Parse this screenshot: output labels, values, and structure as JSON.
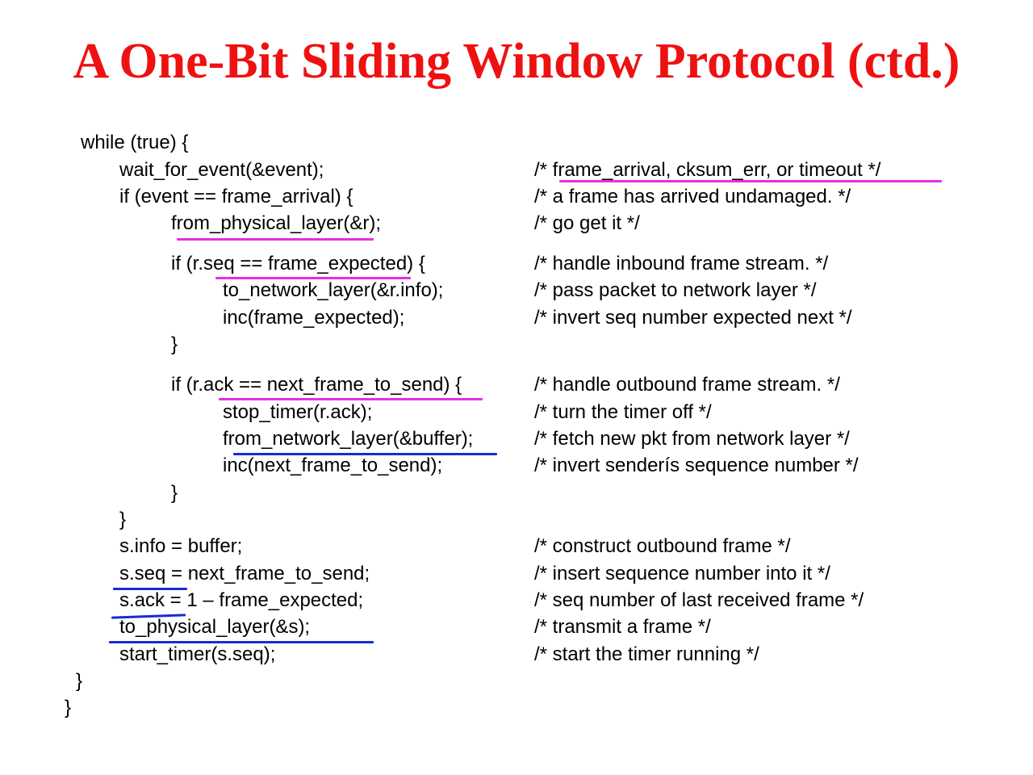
{
  "title": "A One-Bit Sliding Window Protocol (ctd.)",
  "colors": {
    "title": "#ee1111",
    "highlight_magenta": "#e62ee6",
    "highlight_blue": "#1a2ad6"
  },
  "code": [
    {
      "text": "while (true) {",
      "comment": ""
    },
    {
      "text": "wait_for_event(&event);",
      "comment": "/* frame_arrival, cksum_err, or timeout */"
    },
    {
      "text": "if (event == frame_arrival) {",
      "comment": "/* a frame has arrived undamaged. */"
    },
    {
      "text": "from_physical_layer(&r);",
      "comment": "/* go get it */"
    },
    {
      "text": "if (r.seq == frame_expected) {",
      "comment": "/* handle inbound frame stream. */"
    },
    {
      "text": "to_network_layer(&r.info);",
      "comment": "/* pass packet to network layer */"
    },
    {
      "text": "inc(frame_expected);",
      "comment": "/* invert seq number expected next */"
    },
    {
      "text": "}",
      "comment": ""
    },
    {
      "text": "if (r.ack == next_frame_to_send) {",
      "comment": "/* handle outbound frame stream. */"
    },
    {
      "text": "stop_timer(r.ack);",
      "comment": "/* turn the timer off */"
    },
    {
      "text": "from_network_layer(&buffer);",
      "comment": "/* fetch new pkt from network layer */"
    },
    {
      "text": "inc(next_frame_to_send);",
      "comment": "/* invert senderís sequence number */"
    },
    {
      "text": "}",
      "comment": ""
    },
    {
      "text": "}",
      "comment": ""
    },
    {
      "text": "s.info = buffer;",
      "comment": "/* construct outbound frame */"
    },
    {
      "text": "s.seq = next_frame_to_send;",
      "comment": "/* insert sequence number into it */"
    },
    {
      "text": "s.ack = 1 – frame_expected;",
      "comment": "/* seq number of last received frame */"
    },
    {
      "text": "to_physical_layer(&s);",
      "comment": "/* transmit a frame */"
    },
    {
      "text": "start_timer(s.seq);",
      "comment": "/* start the timer running */"
    },
    {
      "text": "}",
      "comment": ""
    },
    {
      "text": "}",
      "comment": ""
    }
  ]
}
